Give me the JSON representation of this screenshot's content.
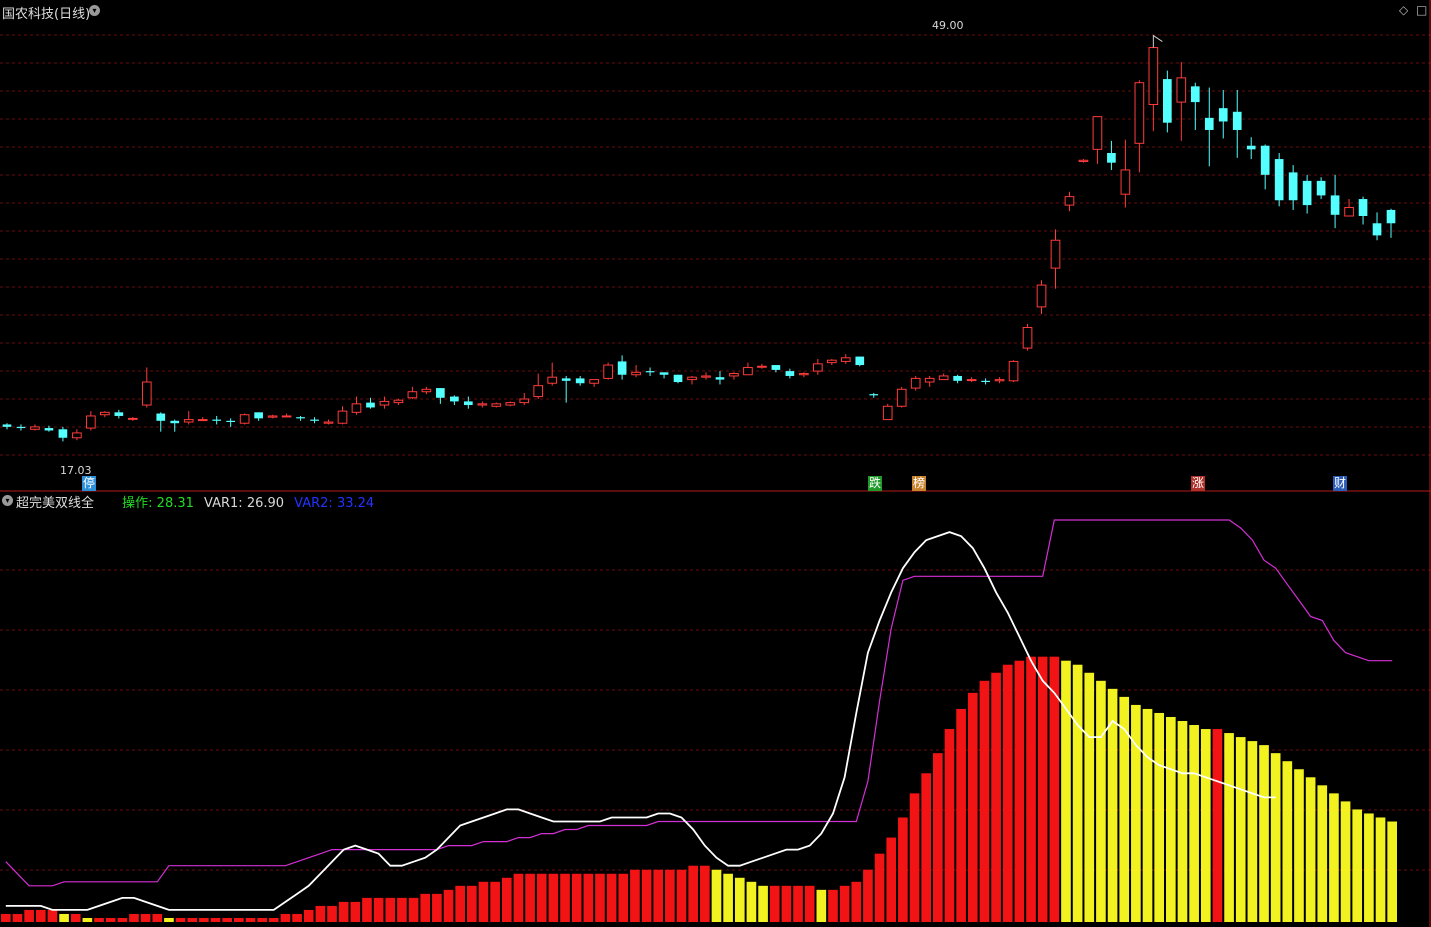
{
  "main_panel": {
    "title": "国农科技(日线)",
    "high_label": "49.00",
    "low_label": "17.03",
    "markers": [
      {
        "text": "停",
        "color": "#2d8fd8"
      },
      {
        "text": "跌",
        "color": "#1f9a2a"
      },
      {
        "text": "榜",
        "color": "#c9832c"
      },
      {
        "text": "涨",
        "color": "#b0302a"
      },
      {
        "text": "财",
        "color": "#2b5cb8"
      }
    ],
    "controls": {
      "diamond": "◇",
      "square": "□"
    }
  },
  "indicator_panel": {
    "name": "超完美双线全",
    "v1_label": "操作: ",
    "v1_value": "28.31",
    "v2_label": "VAR1: ",
    "v2_value": "26.90",
    "v3_label": "VAR2: ",
    "v3_value": "33.24"
  },
  "colors": {
    "background": "#000000",
    "bg_grid": "#6a0d0d",
    "divider": "#b51a1a",
    "candle_up": "#ff3b3b",
    "candle_down": "#54ffff",
    "hist_up": "#ff1515",
    "hist_down": "#ffff22",
    "line_white": "#ffffff",
    "line_magenta": "#d42fd4",
    "line_yellow": "#c8c830",
    "value_green": "#22dd22",
    "value_white": "#d8d8d8",
    "value_blue": "#2233ff"
  },
  "chart_data": [
    {
      "type": "candlestick",
      "title": "国农科技(日线)",
      "high": 49.0,
      "low": 17.03,
      "ylim": [
        14.8,
        52.1
      ],
      "days": 100,
      "candles": [
        [
          17.9,
          17.7,
          18.0,
          17.5
        ],
        [
          17.7,
          17.6,
          17.9,
          17.4
        ],
        [
          17.5,
          17.7,
          17.9,
          17.4
        ],
        [
          17.6,
          17.4,
          17.8,
          17.3
        ],
        [
          17.5,
          16.8,
          17.7,
          16.5
        ],
        [
          16.8,
          17.2,
          17.5,
          16.6
        ],
        [
          17.6,
          18.6,
          19.0,
          17.4
        ],
        [
          18.7,
          18.9,
          19.0,
          18.5
        ],
        [
          18.9,
          18.6,
          19.1,
          18.4
        ],
        [
          18.4,
          18.4,
          18.5,
          18.2
        ],
        [
          19.5,
          21.4,
          22.6,
          19.3
        ],
        [
          18.8,
          18.2,
          18.9,
          17.3
        ],
        [
          18.2,
          18.0,
          18.3,
          17.3
        ],
        [
          18.1,
          18.3,
          19.0,
          17.9
        ],
        [
          18.3,
          18.3,
          18.5,
          18.2
        ],
        [
          18.3,
          18.2,
          18.6,
          17.9
        ],
        [
          18.2,
          18.1,
          18.4,
          17.7
        ],
        [
          18.0,
          18.7,
          18.8,
          17.9
        ],
        [
          18.9,
          18.4,
          18.9,
          18.2
        ],
        [
          18.5,
          18.6,
          18.7,
          18.4
        ],
        [
          18.6,
          18.6,
          18.8,
          18.5
        ],
        [
          18.5,
          18.4,
          18.6,
          18.2
        ],
        [
          18.3,
          18.2,
          18.5,
          18.0
        ],
        [
          18.0,
          18.1,
          18.3,
          17.9
        ],
        [
          18.0,
          19.0,
          19.4,
          17.9
        ],
        [
          18.9,
          19.6,
          20.2,
          18.7
        ],
        [
          19.7,
          19.3,
          20.1,
          19.2
        ],
        [
          19.5,
          19.8,
          20.2,
          19.2
        ],
        [
          19.7,
          19.9,
          20.0,
          19.5
        ],
        [
          20.1,
          20.6,
          21.0,
          20.0
        ],
        [
          20.6,
          20.8,
          21.0,
          20.4
        ],
        [
          20.9,
          20.1,
          20.9,
          19.6
        ],
        [
          20.2,
          19.8,
          20.3,
          19.5
        ],
        [
          19.8,
          19.5,
          20.2,
          19.2
        ],
        [
          19.5,
          19.6,
          19.8,
          19.3
        ],
        [
          19.4,
          19.6,
          19.7,
          19.3
        ],
        [
          19.5,
          19.7,
          19.8,
          19.4
        ],
        [
          19.7,
          20.0,
          20.5,
          19.5
        ],
        [
          20.2,
          21.1,
          22.1,
          20.0
        ],
        [
          21.3,
          21.8,
          23.0,
          21.1
        ],
        [
          21.7,
          21.5,
          21.9,
          19.7
        ],
        [
          21.7,
          21.3,
          21.9,
          21.1
        ],
        [
          21.3,
          21.6,
          21.6,
          21.0
        ],
        [
          21.7,
          22.8,
          23.0,
          21.6
        ],
        [
          23.1,
          22.0,
          23.6,
          21.6
        ],
        [
          22.0,
          22.2,
          22.8,
          21.8
        ],
        [
          22.3,
          22.2,
          22.6,
          21.9
        ],
        [
          22.2,
          22.0,
          22.2,
          21.7
        ],
        [
          22.0,
          21.4,
          22.0,
          21.3
        ],
        [
          21.6,
          21.8,
          21.9,
          21.2
        ],
        [
          21.8,
          21.9,
          22.2,
          21.6
        ],
        [
          21.8,
          21.6,
          22.3,
          21.2
        ],
        [
          21.9,
          22.1,
          22.2,
          21.6
        ],
        [
          22.0,
          22.6,
          23.0,
          22.0
        ],
        [
          22.7,
          22.7,
          22.9,
          22.5
        ],
        [
          22.8,
          22.4,
          22.8,
          22.2
        ],
        [
          22.3,
          21.9,
          22.5,
          21.7
        ],
        [
          22.0,
          22.1,
          22.2,
          21.8
        ],
        [
          22.3,
          22.9,
          23.3,
          22.0
        ],
        [
          23.0,
          23.2,
          23.3,
          22.8
        ],
        [
          23.1,
          23.4,
          23.7,
          22.9
        ],
        [
          23.5,
          22.8,
          23.5,
          22.7
        ],
        [
          20.4,
          20.3,
          20.5,
          20.1
        ],
        [
          18.3,
          19.4,
          19.6,
          18.3
        ],
        [
          19.4,
          20.8,
          21.0,
          19.3
        ],
        [
          20.9,
          21.7,
          21.9,
          20.7
        ],
        [
          21.4,
          21.7,
          21.9,
          21.0
        ],
        [
          21.6,
          21.9,
          22.1,
          21.6
        ],
        [
          21.9,
          21.5,
          22.0,
          21.3
        ],
        [
          21.6,
          21.6,
          21.8,
          21.4
        ],
        [
          21.5,
          21.4,
          21.7,
          21.2
        ],
        [
          21.5,
          21.6,
          21.8,
          21.3
        ],
        [
          21.5,
          23.1,
          23.2,
          21.4
        ],
        [
          24.2,
          25.9,
          26.2,
          24.0
        ],
        [
          27.6,
          29.4,
          29.8,
          27.0
        ],
        [
          30.8,
          33.1,
          34.0,
          29.1
        ],
        [
          36.0,
          36.7,
          37.1,
          35.5
        ],
        [
          39.6,
          39.7,
          39.8,
          39.5
        ],
        [
          40.6,
          43.3,
          43.3,
          39.4
        ],
        [
          40.3,
          39.5,
          41.3,
          38.9
        ],
        [
          36.9,
          38.9,
          41.4,
          35.8
        ],
        [
          41.1,
          46.1,
          46.3,
          38.7
        ],
        [
          44.3,
          49.0,
          49.0,
          42.1
        ],
        [
          46.4,
          42.8,
          47.1,
          42.0
        ],
        [
          44.5,
          46.5,
          47.8,
          41.3
        ],
        [
          45.8,
          44.5,
          46.1,
          42.2
        ],
        [
          43.2,
          42.2,
          45.7,
          39.2
        ],
        [
          44.0,
          42.9,
          45.5,
          41.5
        ],
        [
          43.7,
          42.2,
          45.5,
          39.9
        ],
        [
          40.9,
          40.6,
          41.6,
          39.8
        ],
        [
          40.9,
          38.5,
          41.0,
          37.3
        ],
        [
          39.8,
          36.4,
          40.3,
          35.9
        ],
        [
          38.7,
          36.4,
          39.3,
          35.6
        ],
        [
          38.0,
          36.0,
          38.5,
          35.3
        ],
        [
          38.0,
          36.8,
          38.3,
          36.5
        ],
        [
          36.8,
          35.2,
          38.5,
          34.1
        ],
        [
          35.1,
          35.8,
          36.5,
          35.3
        ],
        [
          36.5,
          35.1,
          36.7,
          34.4
        ],
        [
          34.5,
          33.5,
          35.4,
          33.1
        ],
        [
          35.6,
          34.5,
          35.7,
          33.3
        ]
      ]
    },
    {
      "type": "line",
      "title": "超完美双线全",
      "ylim": [
        0,
        100
      ],
      "series": [
        {
          "name": "操作",
          "color": "#ffffff",
          "last": 28.31
        },
        {
          "name": "VAR1",
          "color": "#d8d8d8",
          "last": 26.9
        },
        {
          "name": "VAR2",
          "color": "#2233ff",
          "last": 33.24
        }
      ],
      "histogram": [
        2,
        2,
        3,
        3,
        3,
        2,
        2,
        1,
        1,
        1,
        1,
        2,
        2,
        2,
        1,
        1,
        1,
        1,
        1,
        1,
        1,
        1,
        1,
        1,
        2,
        2,
        3,
        4,
        4,
        5,
        5,
        6,
        6,
        6,
        6,
        6,
        7,
        7,
        8,
        9,
        9,
        10,
        10,
        11,
        12,
        12,
        12,
        12,
        12,
        12,
        12,
        12,
        12,
        12,
        13,
        13,
        13,
        13,
        13,
        14,
        14,
        13,
        12,
        11,
        10,
        9,
        9,
        9,
        9,
        9,
        8,
        8,
        9,
        10,
        13,
        17,
        21,
        26,
        32,
        37,
        42,
        48,
        53,
        57,
        60,
        62,
        64,
        65,
        66,
        66,
        66,
        65,
        64,
        62,
        60,
        58,
        56,
        54,
        53,
        52,
        51,
        50,
        49,
        48,
        48,
        47,
        46,
        45,
        44,
        42,
        40,
        38,
        36,
        34,
        32,
        30,
        28,
        27,
        26,
        25
      ],
      "white_line": [
        4,
        4,
        4,
        4,
        3,
        3,
        3,
        3,
        4,
        5,
        6,
        6,
        5,
        4,
        3,
        3,
        3,
        3,
        3,
        3,
        3,
        3,
        3,
        3,
        5,
        7,
        9,
        12,
        15,
        18,
        19,
        18,
        17,
        14,
        14,
        15,
        16,
        18,
        21,
        24,
        25,
        26,
        27,
        28,
        28,
        27,
        26,
        25,
        25,
        25,
        25,
        25,
        26,
        26,
        26,
        26,
        27,
        27,
        26,
        23,
        19,
        16,
        14,
        14,
        15,
        16,
        17,
        18,
        18,
        19,
        22,
        27,
        36,
        52,
        67,
        75,
        82,
        88,
        92,
        95,
        96,
        97,
        96,
        93,
        88,
        82,
        77,
        71,
        65,
        60,
        57,
        53,
        49,
        46,
        46,
        50,
        48,
        44,
        41,
        39,
        38,
        37,
        37,
        36,
        35,
        34,
        33,
        32,
        31,
        31
      ],
      "magenta_line": [
        15,
        12,
        9,
        9,
        9,
        10,
        10,
        10,
        10,
        10,
        10,
        10,
        10,
        10,
        14,
        14,
        14,
        14,
        14,
        14,
        14,
        14,
        14,
        14,
        14,
        15,
        16,
        17,
        18,
        18,
        18,
        18,
        18,
        18,
        18,
        18,
        18,
        18,
        19,
        19,
        19,
        20,
        20,
        20,
        21,
        21,
        22,
        22,
        23,
        23,
        24,
        24,
        24,
        24,
        24,
        24,
        25,
        25,
        25,
        25,
        25,
        25,
        25,
        25,
        25,
        25,
        25,
        25,
        25,
        25,
        25,
        25,
        25,
        25,
        35,
        55,
        73,
        85,
        86,
        86,
        86,
        86,
        86,
        86,
        86,
        86,
        86,
        86,
        86,
        86,
        100,
        100,
        100,
        100,
        100,
        100,
        100,
        100,
        100,
        100,
        100,
        100,
        100,
        100,
        100,
        100,
        98,
        95,
        90,
        88,
        84,
        80,
        76,
        75,
        70,
        67,
        66,
        65,
        65,
        65
      ],
      "yellow_line": [
        0,
        0,
        0,
        0,
        0,
        0,
        0,
        0,
        0,
        0,
        0,
        0,
        0,
        0,
        0,
        0,
        0,
        0,
        0,
        0,
        0,
        0,
        0,
        0,
        0,
        0,
        0,
        0,
        0,
        0,
        0,
        0,
        0,
        0,
        0,
        0,
        0,
        0,
        0,
        0,
        0,
        0,
        0,
        0,
        0,
        0,
        0,
        0,
        0,
        0,
        0,
        0,
        0,
        0,
        0,
        0,
        0,
        0,
        0,
        0,
        0,
        0,
        0,
        0,
        0,
        0,
        0,
        0,
        0,
        0,
        0,
        0,
        0,
        0,
        0,
        0,
        0,
        0,
        0,
        0,
        0,
        0,
        0,
        0,
        0,
        0,
        0,
        0,
        0,
        0,
        0,
        0,
        0,
        0,
        0,
        0,
        0,
        0,
        0,
        0,
        0,
        0,
        0,
        0,
        0,
        0,
        0,
        0,
        0,
        0,
        0,
        0,
        0,
        0,
        0,
        0,
        0,
        0,
        0,
        0
      ]
    }
  ]
}
